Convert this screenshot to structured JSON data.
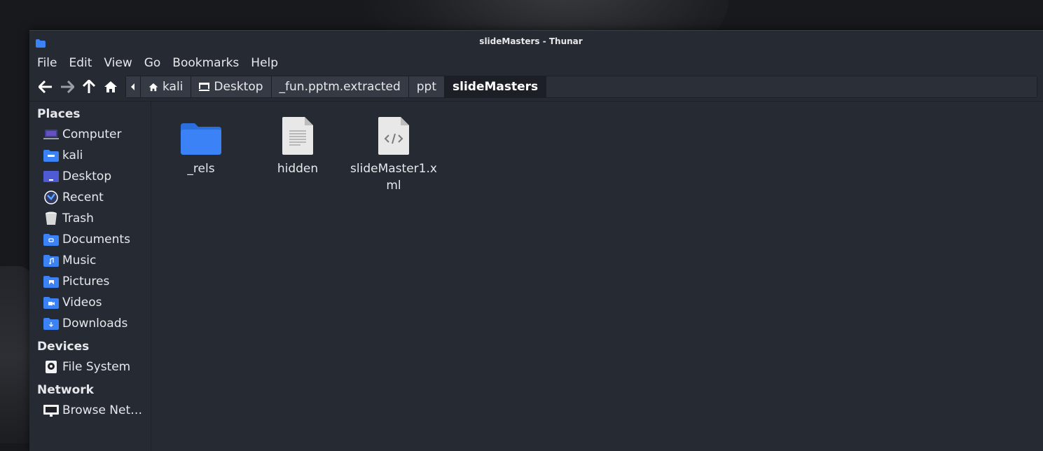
{
  "window": {
    "title": "slideMasters - Thunar"
  },
  "menu": [
    "File",
    "Edit",
    "View",
    "Go",
    "Bookmarks",
    "Help"
  ],
  "breadcrumbs": [
    "kali",
    "Desktop",
    "_fun.pptm.extracted",
    "ppt",
    "slideMasters"
  ],
  "sidebar": {
    "places_heading": "Places",
    "places": [
      {
        "label": "Computer",
        "icon": "computer-icon"
      },
      {
        "label": "kali",
        "icon": "home-folder-icon"
      },
      {
        "label": "Desktop",
        "icon": "desktop-icon"
      },
      {
        "label": "Recent",
        "icon": "recent-icon"
      },
      {
        "label": "Trash",
        "icon": "trash-icon"
      },
      {
        "label": "Documents",
        "icon": "documents-folder-icon"
      },
      {
        "label": "Music",
        "icon": "music-folder-icon"
      },
      {
        "label": "Pictures",
        "icon": "pictures-folder-icon"
      },
      {
        "label": "Videos",
        "icon": "videos-folder-icon"
      },
      {
        "label": "Downloads",
        "icon": "downloads-folder-icon"
      }
    ],
    "devices_heading": "Devices",
    "devices": [
      {
        "label": "File System",
        "icon": "drive-icon"
      }
    ],
    "network_heading": "Network",
    "network": [
      {
        "label": "Browse Net…",
        "icon": "network-icon"
      }
    ]
  },
  "files": [
    {
      "name": "_rels",
      "icon": "folder-icon"
    },
    {
      "name": "hidden",
      "icon": "text-file-icon"
    },
    {
      "name": "slideMaster1.xml",
      "icon": "xml-file-icon"
    }
  ],
  "colors": {
    "accent": "#3b82f6",
    "background": "#262a33"
  }
}
